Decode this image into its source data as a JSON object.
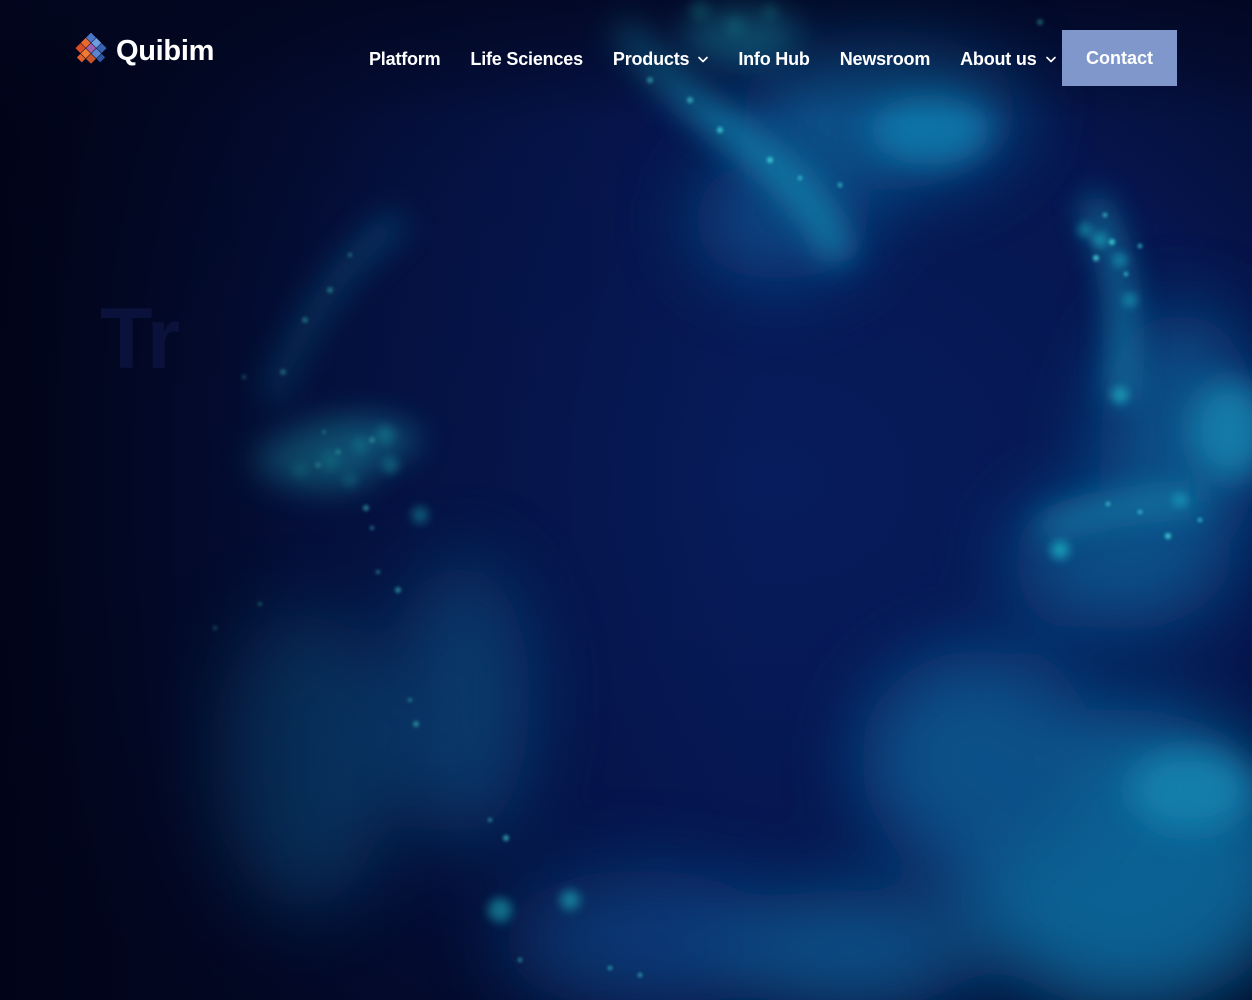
{
  "brand": {
    "name": "Quibim"
  },
  "nav": {
    "items": [
      {
        "label": "Platform",
        "has_dropdown": false
      },
      {
        "label": "Life Sciences",
        "has_dropdown": false
      },
      {
        "label": "Products",
        "has_dropdown": true
      },
      {
        "label": "Info Hub",
        "has_dropdown": false
      },
      {
        "label": "Newsroom",
        "has_dropdown": false
      },
      {
        "label": "About us",
        "has_dropdown": true
      }
    ],
    "contact_label": "Contact"
  },
  "hero": {
    "heading_visible": "Tr"
  },
  "colors": {
    "background": "#040a2e",
    "accent_button": "#7f97ca",
    "glow_cyan": "#1fb7c9",
    "glow_blue": "#0b5f97"
  }
}
